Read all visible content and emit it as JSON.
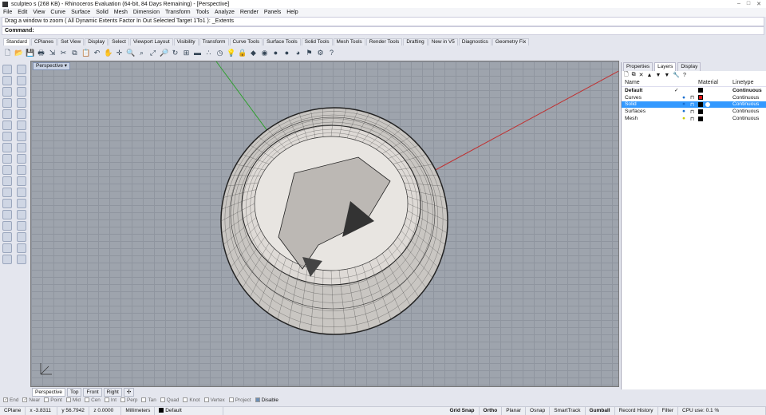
{
  "title": "sculpteo s (268 KB) - Rhinoceros Evaluation (64-bit, 84 Days Remaining) - [Perspective]",
  "menu": [
    "File",
    "Edit",
    "View",
    "Curve",
    "Surface",
    "Solid",
    "Mesh",
    "Dimension",
    "Transform",
    "Tools",
    "Analyze",
    "Render",
    "Panels",
    "Help"
  ],
  "command_history": "Drag a window to zoom ( All  Dynamic  Extents  Factor  In  Out  Selected  Target  1To1 ): _Extents",
  "command_label": "Command:",
  "toolbar_tabs": [
    "Standard",
    "CPlanes",
    "Set View",
    "Display",
    "Select",
    "Viewport Layout",
    "Visibility",
    "Transform",
    "Curve Tools",
    "Surface Tools",
    "Solid Tools",
    "Mesh Tools",
    "Render Tools",
    "Drafting",
    "New in V5",
    "Diagnostics",
    "Geometry Fix"
  ],
  "toolbar_icons": [
    "new",
    "open",
    "save",
    "print",
    "import",
    "cut",
    "copy",
    "paste",
    "undo",
    "pan",
    "move",
    "zoom",
    "zoom-window",
    "zoom-extents",
    "zoom-selected",
    "rotate",
    "viewports",
    "cplane",
    "snap",
    "distance",
    "lights",
    "lock",
    "layers",
    "color",
    "material",
    "render",
    "environment",
    "filter",
    "options",
    "help"
  ],
  "viewport": {
    "name": "Perspective",
    "axis_colors": {
      "x": "#c03030",
      "y": "#30a030"
    }
  },
  "viewport_tabs": [
    "Perspective",
    "Top",
    "Front",
    "Right"
  ],
  "osnaps": [
    {
      "label": "End",
      "checked": true
    },
    {
      "label": "Near",
      "checked": true
    },
    {
      "label": "Point",
      "checked": false
    },
    {
      "label": "Mid",
      "checked": false
    },
    {
      "label": "Cen",
      "checked": false
    },
    {
      "label": "Int",
      "checked": false
    },
    {
      "label": "Perp",
      "checked": false
    },
    {
      "label": "Tan",
      "checked": false
    },
    {
      "label": "Quad",
      "checked": false
    },
    {
      "label": "Knot",
      "checked": false
    },
    {
      "label": "Vertex",
      "checked": false
    },
    {
      "label": "Project",
      "checked": false
    },
    {
      "label": "Disable",
      "checked": false
    }
  ],
  "status": {
    "cplane": "CPlane",
    "x": "x -3.8311",
    "y": "y 56.7942",
    "z": "z 0.0000",
    "units": "Millimeters",
    "layer": "Default",
    "grid_snap": "Grid Snap",
    "ortho": "Ortho",
    "planar": "Planar",
    "osnap": "Osnap",
    "smarttrack": "SmartTrack",
    "gumball": "Gumball",
    "record_history": "Record History",
    "filter": "Filter",
    "cpu": "CPU use: 0.1 %"
  },
  "panel": {
    "tabs": [
      "Properties",
      "Layers",
      "Display"
    ],
    "active_tab": "Layers",
    "columns": {
      "name": "Name",
      "material": "Material",
      "linetype": "Linetype"
    },
    "layers": [
      {
        "name": "Default",
        "current": true,
        "color": "#000000",
        "linetype": "Continuous"
      },
      {
        "name": "Curves",
        "current": false,
        "color": "#e01010",
        "linetype": "Continuous"
      },
      {
        "name": "Solid",
        "current": false,
        "color": "#000000",
        "linetype": "Continuous",
        "selected": true
      },
      {
        "name": "Surfaces",
        "current": false,
        "color": "#000000",
        "linetype": "Continuous"
      },
      {
        "name": "Mesh",
        "current": false,
        "color": "#000000",
        "linetype": "Continuous"
      }
    ]
  }
}
